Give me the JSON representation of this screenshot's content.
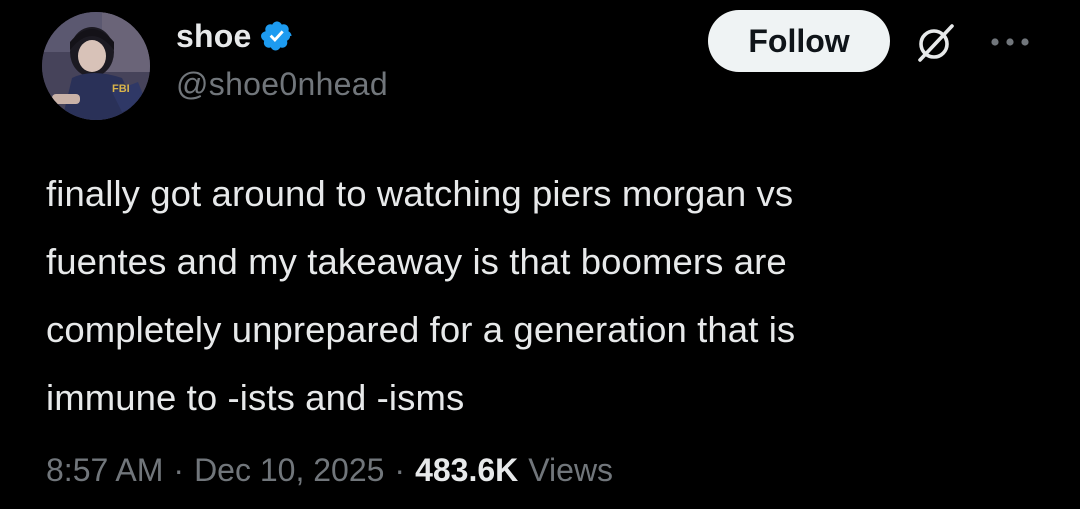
{
  "author": {
    "display_name": "shoe",
    "handle": "@shoe0nhead",
    "verified": true,
    "verified_color": "#1d9bf0"
  },
  "actions": {
    "follow_label": "Follow",
    "grok_icon": "grok-slash-circle-icon",
    "more_icon": "more-dots-icon"
  },
  "tweet": {
    "text": "finally got around to watching piers morgan vs\nfuentes and my takeaway is that boomers are\ncompletely unprepared for a generation that is\nimmune to -ists and -isms"
  },
  "meta": {
    "time": "8:57 AM",
    "separator": "·",
    "date": "Dec 10, 2025",
    "views_count": "483.6K",
    "views_label": "Views"
  },
  "colors": {
    "background": "#000000",
    "primary_text": "#e7e9ea",
    "secondary_text": "#71767b",
    "follow_bg": "#eff3f4",
    "follow_text": "#0f1419"
  }
}
